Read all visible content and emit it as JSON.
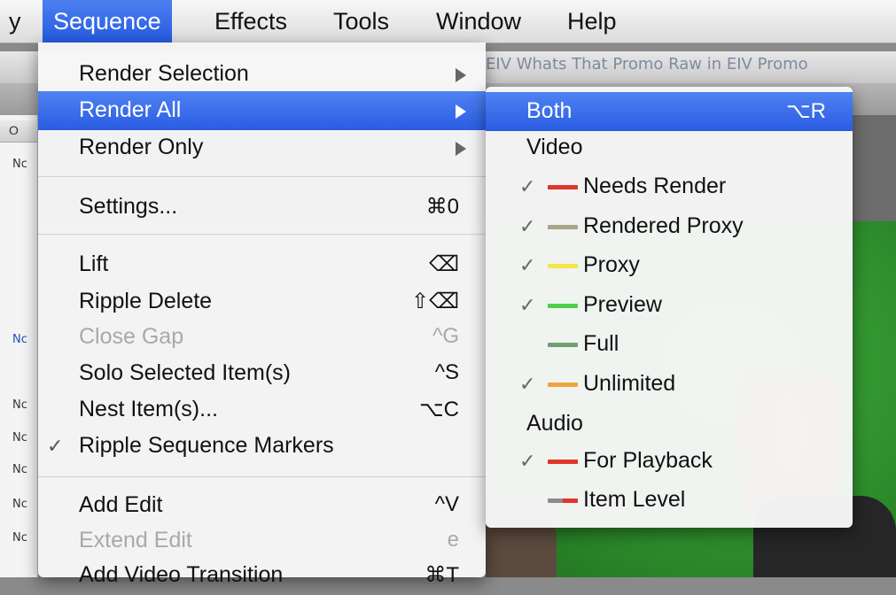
{
  "menubar": {
    "items": [
      {
        "label": "y"
      },
      {
        "label": "Sequence"
      },
      {
        "label": "Effects"
      },
      {
        "label": "Tools"
      },
      {
        "label": "Window"
      },
      {
        "label": "Help"
      }
    ]
  },
  "background": {
    "window_title": "EIV Whats That Promo Raw in EIV Promo",
    "column_header": "O",
    "rows": [
      "Nc",
      "Nc",
      "Nc",
      "Nc",
      "Nc",
      "Nc",
      "Nc"
    ]
  },
  "sequence_menu": {
    "items": [
      {
        "label": "Render Selection"
      },
      {
        "label": "Render All"
      },
      {
        "label": "Render Only"
      },
      {
        "label": "Settings...",
        "shortcut": "⌘0"
      },
      {
        "label": "Lift",
        "shortcut": "⌫"
      },
      {
        "label": "Ripple Delete",
        "shortcut": "⇧⌫"
      },
      {
        "label": "Close Gap",
        "shortcut": "^G"
      },
      {
        "label": "Solo Selected Item(s)",
        "shortcut": "^S"
      },
      {
        "label": "Nest Item(s)...",
        "shortcut": "⌥C"
      },
      {
        "label": "Ripple Sequence Markers",
        "check": "✓"
      },
      {
        "label": "Add Edit",
        "shortcut": "^V"
      },
      {
        "label": "Extend Edit",
        "shortcut": "e"
      },
      {
        "label": "Add Video Transition",
        "shortcut": "⌘T"
      }
    ]
  },
  "render_all_submenu": {
    "items": [
      {
        "label": "Both",
        "shortcut": "⌥R"
      },
      {
        "label": "Video"
      },
      {
        "label": "Needs Render",
        "check": "✓",
        "color": "#e0362c"
      },
      {
        "label": "Rendered Proxy",
        "check": "✓",
        "color": "#a8a58a"
      },
      {
        "label": "Proxy",
        "check": "✓",
        "color": "#f2e64a"
      },
      {
        "label": "Preview",
        "check": "✓",
        "color": "#4fd04a"
      },
      {
        "label": "Full",
        "color": "#6fa06f"
      },
      {
        "label": "Unlimited",
        "check": "✓",
        "color": "#f0a63a"
      },
      {
        "label": "Audio"
      },
      {
        "label": "For Playback",
        "check": "✓",
        "color": "#e0362c"
      },
      {
        "label": "Item Level"
      }
    ]
  }
}
